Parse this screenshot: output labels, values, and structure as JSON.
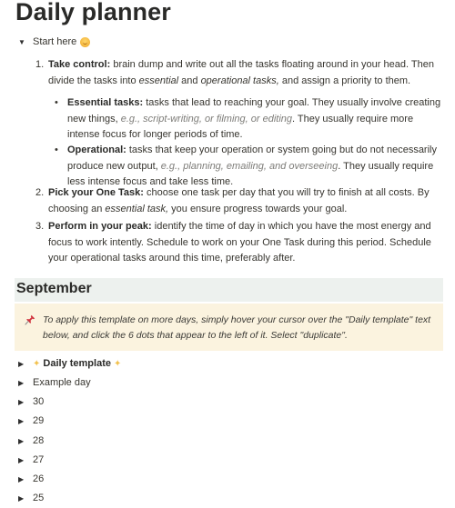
{
  "page": {
    "title": "Daily planner",
    "start_toggle": {
      "label": "Start here",
      "emoji": "smiling-face",
      "expanded": true
    },
    "steps": [
      {
        "number": "1.",
        "bold": "Take control:",
        "text_a": " brain dump and write out all the tasks floating around in your head. Then divide the tasks into ",
        "em1": "essential",
        "text_b": " and ",
        "em2": "operational tasks,",
        "text_c": " and assign a priority to them."
      },
      {
        "number": "2.",
        "bold": "Pick your One Task:",
        "text_a": " choose one task per day that you will try to finish at all costs. By choosing an ",
        "em1": "essential task,",
        "text_b": " you ensure progress towards your goal."
      },
      {
        "number": "3.",
        "bold": "Perform in your peak:",
        "text_a": " identify the time of day in which you have the most energy and focus to work intently. Schedule to work on your One Task during this period. Schedule your operational tasks around this time, preferably after."
      }
    ],
    "sub_bullets": [
      {
        "bold": "Essential tasks:",
        "text_a": " tasks that lead to reaching your goal. They usually involve creating new things, ",
        "example": "e.g., script-writing, or filming, or editing",
        "text_b": ". They usually require more intense focus for longer periods of time."
      },
      {
        "bold": "Operational:",
        "text_a": " tasks that keep your operation or system going but do not necessarily produce new output, ",
        "example": "e.g., planning, emailing, and overseeing",
        "text_b": ". They usually require less intense focus and take less time."
      }
    ]
  },
  "section": {
    "heading": "September",
    "callout": {
      "icon": "pushpin",
      "text": "To apply this template on more days, simply hover your cursor over the \"Daily template\" text below, and click the 6 dots that appear to the left of it. Select \"duplicate\"."
    },
    "template_toggle": {
      "label": "Daily template",
      "icon": "sparkles"
    },
    "day_toggles": [
      "Example day",
      "30",
      "29",
      "28",
      "27",
      "26",
      "25"
    ]
  },
  "colors": {
    "heading_band": "#edf1ee",
    "callout_bg": "#fbf3df",
    "text": "#37352f",
    "example_text": "#7d7c78",
    "pushpin": "#d0343f",
    "sparkle": "#f2c14e"
  }
}
